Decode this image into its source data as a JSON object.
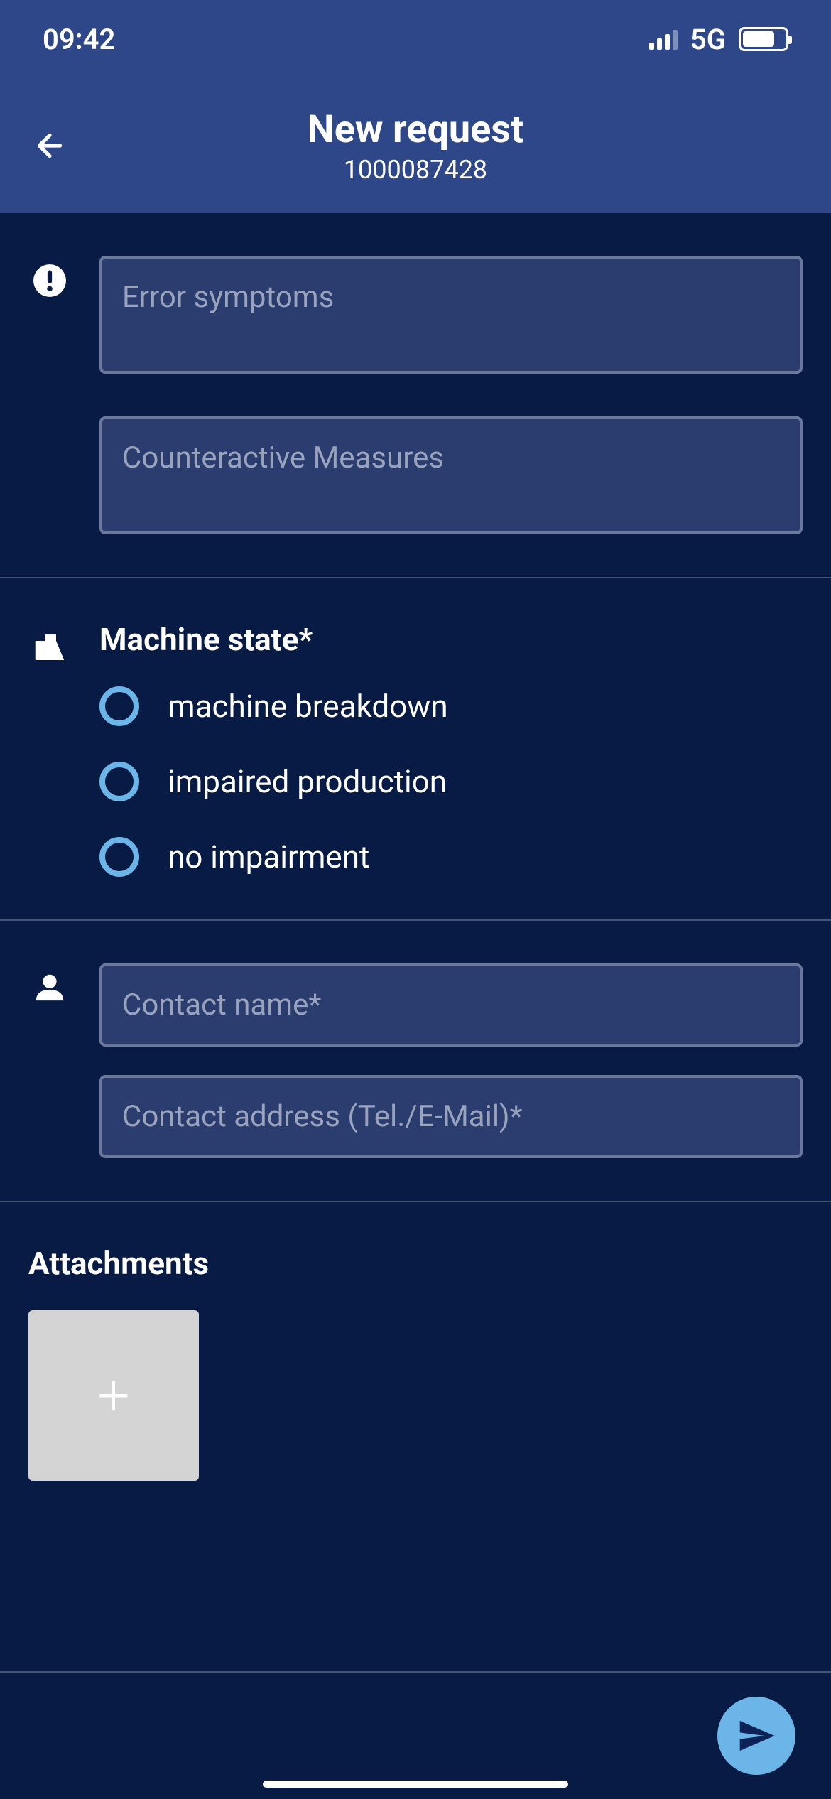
{
  "status": {
    "time": "09:42",
    "network": "5G"
  },
  "header": {
    "title": "New request",
    "subtitle": "1000087428"
  },
  "form": {
    "error_symptoms_placeholder": "Error symptoms",
    "counteractive_placeholder": "Counteractive Measures",
    "machine_state": {
      "title": "Machine state*",
      "options": [
        "machine breakdown",
        "impaired production",
        "no impairment"
      ]
    },
    "contact_name_placeholder": "Contact name*",
    "contact_address_placeholder": "Contact address (Tel./E-Mail)*",
    "attachments_title": "Attachments"
  }
}
